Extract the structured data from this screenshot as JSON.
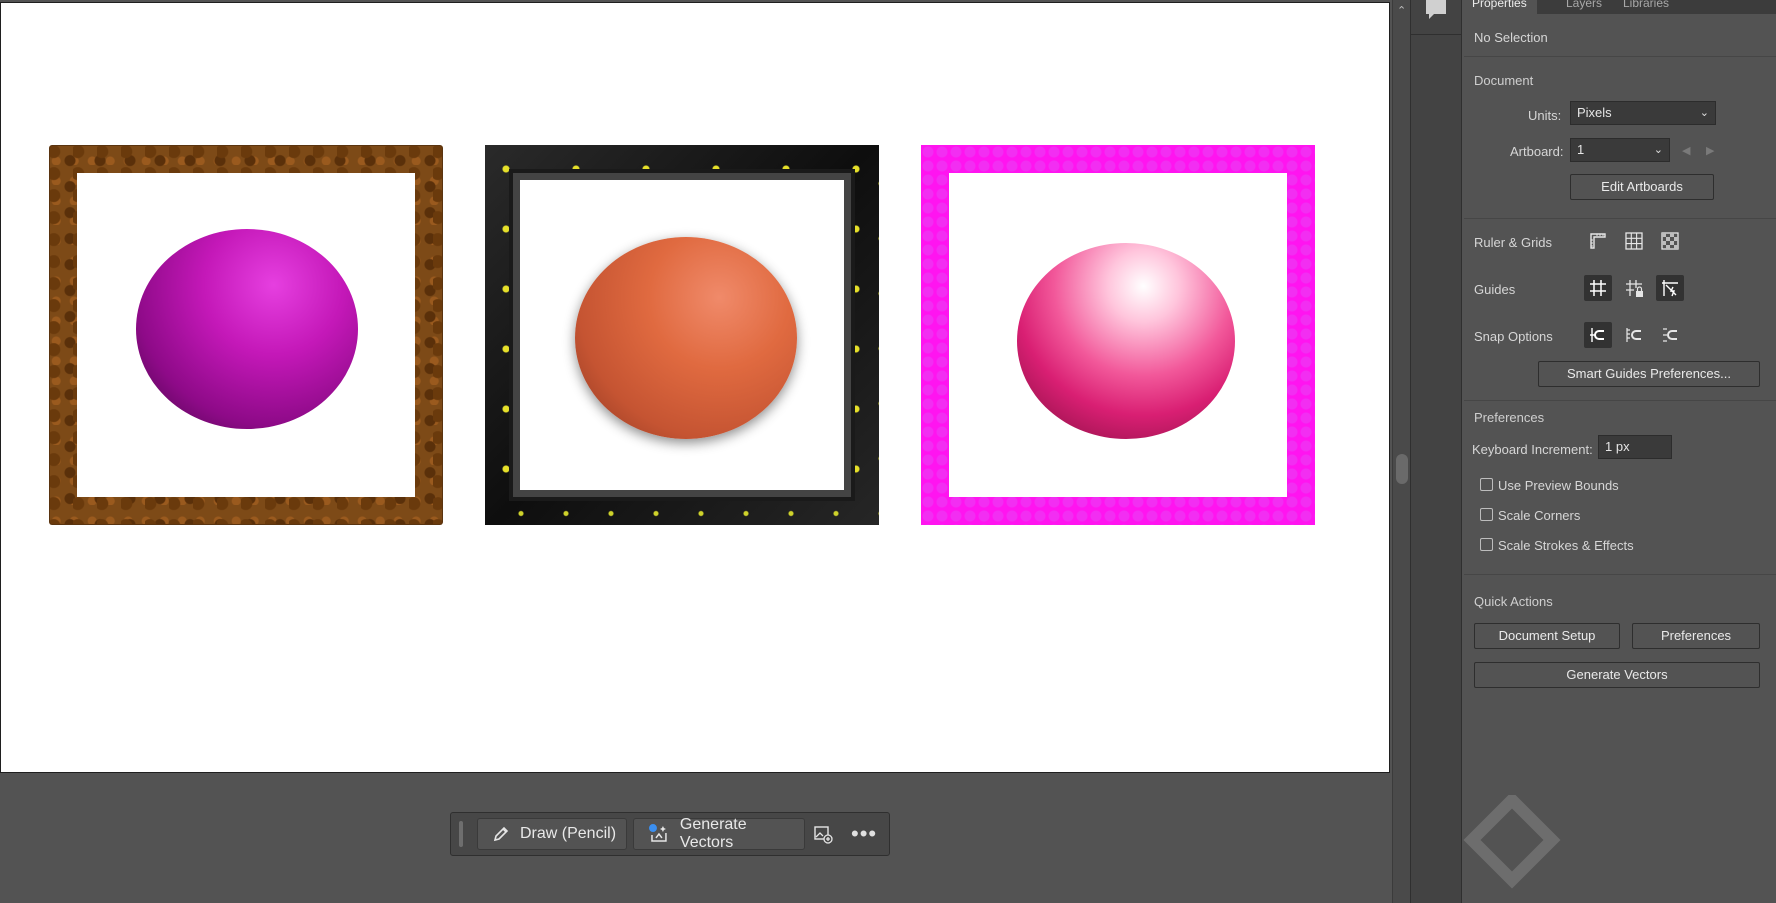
{
  "taskbar": {
    "draw_label": "Draw (Pencil)",
    "generate_label": "Generate Vectors"
  },
  "panel": {
    "tabs": [
      "Properties",
      "Layers",
      "Libraries"
    ],
    "no_selection": "No Selection",
    "document_header": "Document",
    "units_label": "Units:",
    "units_value": "Pixels",
    "artboard_label": "Artboard:",
    "artboard_value": "1",
    "edit_artboards": "Edit Artboards",
    "ruler_grids": "Ruler & Grids",
    "guides": "Guides",
    "snap_options": "Snap Options",
    "smart_guides_btn": "Smart Guides Preferences...",
    "preferences_header": "Preferences",
    "keyboard_increment_label": "Keyboard Increment:",
    "keyboard_increment_value": "1 px",
    "checkboxes": [
      {
        "label": "Use Preview Bounds",
        "checked": false
      },
      {
        "label": "Scale Corners",
        "checked": false
      },
      {
        "label": "Scale Strokes & Effects",
        "checked": false
      }
    ],
    "quick_actions_header": "Quick Actions",
    "document_setup_btn": "Document Setup",
    "preferences_btn": "Preferences",
    "generate_vectors_btn": "Generate Vectors"
  },
  "icons": {
    "pencil": "pencil-icon",
    "generate": "generate-vectors-icon",
    "image_add": "image-add-icon",
    "more": "more-icon",
    "comment": "comment-icon",
    "rulers": "rulers-icon",
    "grid": "grid-icon",
    "transparency_grid": "transparency-grid-icon",
    "guides_show": "guides-icon",
    "guides_lock": "lock-guides-icon",
    "smart_guides": "smart-guides-icon",
    "snap_point": "snap-to-point-icon",
    "snap_pixel": "snap-to-pixel-icon",
    "snap_glyph": "snap-to-glyph-icon"
  },
  "colors": {
    "app_bg": "#535353",
    "artboard": "#ffffff",
    "frame_wood": "#7d4a17",
    "frame_dark": "#1a1a1a",
    "frame_pink": "#ff14f0",
    "sphere_purple": "#c418b8",
    "sphere_orange": "#e06a40",
    "sphere_pink": "#f2589a"
  }
}
